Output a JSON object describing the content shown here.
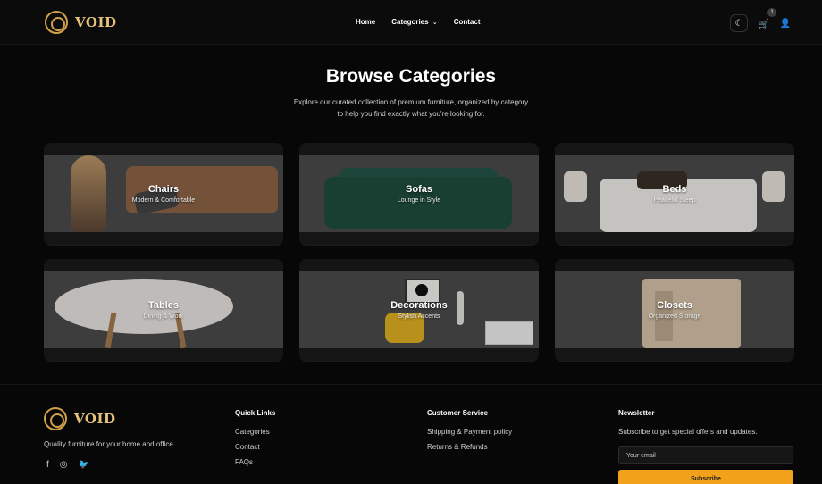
{
  "header": {
    "logo_text": "VOID",
    "nav": [
      "Home",
      "Categories",
      "Contact"
    ],
    "categories_chevron": "⌄",
    "cart_badge": "1",
    "icons": [
      "moon-icon",
      "cart-icon",
      "user-icon"
    ]
  },
  "hero": {
    "title": "Browse Categories",
    "subtitle_line1": "Explore our curated collection of premium furniture, organized by category",
    "subtitle_line2": "to help you find exactly what you're looking for."
  },
  "categories": [
    {
      "title": "Chairs",
      "subtitle": "Modern & Comfortable"
    },
    {
      "title": "Sofas",
      "subtitle": "Lounge in Style"
    },
    {
      "title": "Beds",
      "subtitle": "Peaceful Sleep"
    },
    {
      "title": "Tables",
      "subtitle": "Dining & Work"
    },
    {
      "title": "Decorations",
      "subtitle": "Stylish Accents"
    },
    {
      "title": "Closets",
      "subtitle": "Organized Storage"
    }
  ],
  "footer": {
    "logo_text": "VOID",
    "description": "Quality furniture for your home and office.",
    "quick_links": {
      "title": "Quick Links",
      "items": [
        "Categories",
        "Contact",
        "FAQs"
      ]
    },
    "customer_service": {
      "title": "Customer Service",
      "items": [
        "Shipping & Payment policy",
        "Returns & Refunds"
      ]
    },
    "newsletter": {
      "title": "Newsletter",
      "text": "Subscribe to get special offers and updates.",
      "placeholder": "Your email",
      "button": "Subscribe"
    }
  },
  "colors": {
    "background": "#070707",
    "accent": "#f2a11b",
    "logo": "#e8c27b"
  }
}
